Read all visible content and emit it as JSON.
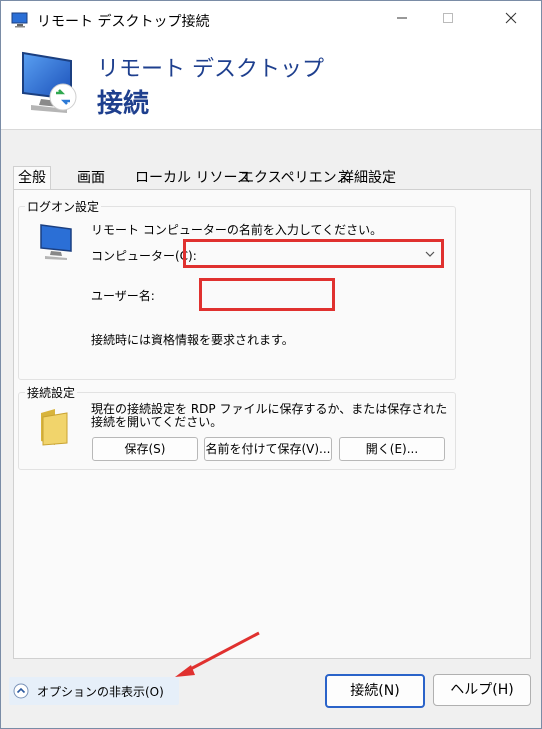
{
  "window": {
    "title": "リモート デスクトップ接続"
  },
  "header": {
    "line1": "リモート デスクトップ",
    "line2": "接続"
  },
  "tabs": [
    {
      "label": "全般"
    },
    {
      "label": "画面"
    },
    {
      "label": "ローカル リソース"
    },
    {
      "label": "エクスペリエンス"
    },
    {
      "label": "詳細設定"
    }
  ],
  "logon": {
    "group_label": "ログオン設定",
    "instruction": "リモート コンピューターの名前を入力してください。",
    "computer_label": "コンピューター(C):",
    "computer_value": "",
    "username_label": "ユーザー名:",
    "username_value": "",
    "credentials_note": "接続時には資格情報を要求されます。"
  },
  "connection": {
    "group_label": "接続設定",
    "description_line1": "現在の接続設定を RDP ファイルに保存するか、または保存された",
    "description_line2": "接続を開いてください。",
    "save_label": "保存(S)",
    "save_as_label": "名前を付けて保存(V)...",
    "open_label": "開く(E)..."
  },
  "footer": {
    "options_label": "オプションの非表示(O)",
    "connect_label": "接続(N)",
    "help_label": "ヘルプ(H)"
  },
  "colors": {
    "accent": "#1e3f8e",
    "highlight": "#e0312f",
    "primary_button_border": "#2a63c9"
  }
}
